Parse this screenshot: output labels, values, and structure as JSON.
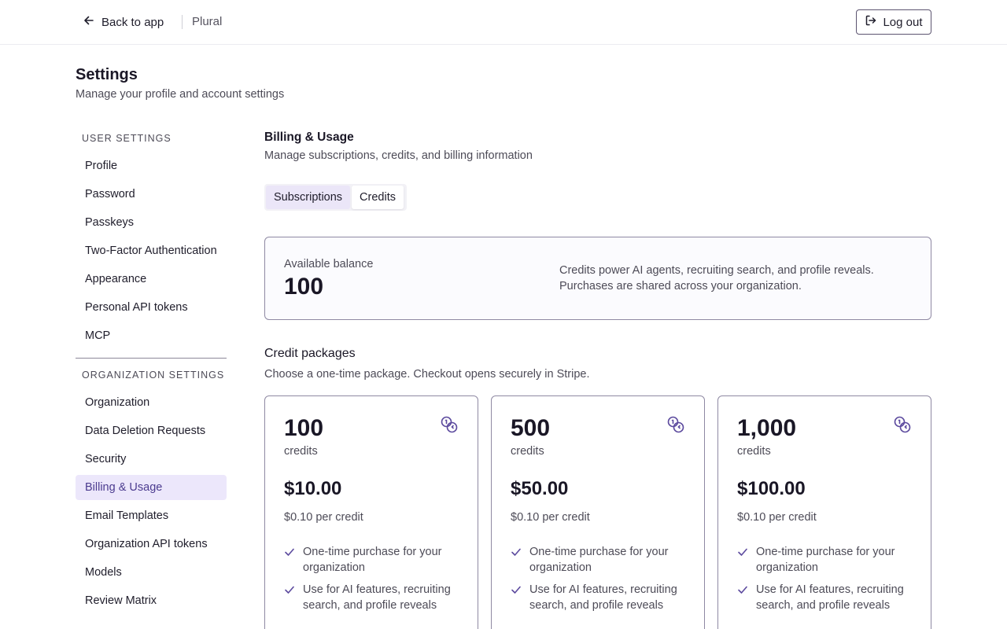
{
  "header": {
    "back_label": "Back to app",
    "brand": "Plural",
    "logout_label": "Log out"
  },
  "page": {
    "title": "Settings",
    "subtitle": "Manage your profile and account settings"
  },
  "sidebar": {
    "user_heading": "USER SETTINGS",
    "user_items": [
      "Profile",
      "Password",
      "Passkeys",
      "Two-Factor Authentication",
      "Appearance",
      "Personal API tokens",
      "MCP"
    ],
    "org_heading": "ORGANIZATION SETTINGS",
    "org_items": [
      "Organization",
      "Data Deletion Requests",
      "Security",
      "Billing & Usage",
      "Email Templates",
      "Organization API tokens",
      "Models",
      "Review Matrix"
    ],
    "active_item": "Billing & Usage"
  },
  "section": {
    "title": "Billing & Usage",
    "subtitle": "Manage subscriptions, credits, and billing information",
    "tabs": [
      "Subscriptions",
      "Credits"
    ]
  },
  "balance": {
    "label": "Available balance",
    "value": "100",
    "note": "Credits power AI agents, recruiting search, and profile reveals. Purchases are shared across your organization."
  },
  "packages": {
    "title": "Credit packages",
    "subtitle": "Choose a one-time package. Checkout opens securely in Stripe.",
    "items": [
      {
        "amount": "100",
        "unit": "credits",
        "price": "$10.00",
        "per_credit": "$0.10 per credit",
        "features": [
          "One-time purchase for your organization",
          "Use for AI features, recruiting search, and profile reveals"
        ]
      },
      {
        "amount": "500",
        "unit": "credits",
        "price": "$50.00",
        "per_credit": "$0.10 per credit",
        "features": [
          "One-time purchase for your organization",
          "Use for AI features, recruiting search, and profile reveals"
        ]
      },
      {
        "amount": "1,000",
        "unit": "credits",
        "price": "$100.00",
        "per_credit": "$0.10 per credit",
        "features": [
          "One-time purchase for your organization",
          "Use for AI features, recruiting search, and profile reveals"
        ]
      }
    ]
  },
  "icons": {
    "back": "arrow-left-icon",
    "logout": "log-out-icon",
    "coins": "coins-icon",
    "check": "check-icon"
  },
  "colors": {
    "accent": "#5c4a9e",
    "active_bg": "#ece7fb",
    "card_border": "#8f89a3"
  }
}
